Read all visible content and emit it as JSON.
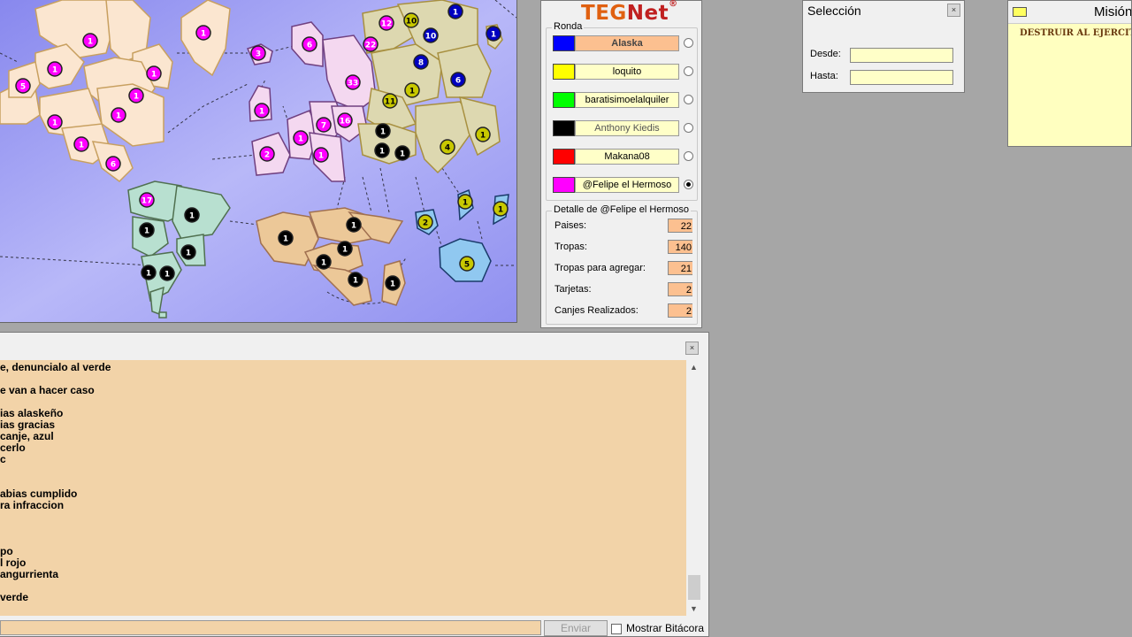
{
  "map": {
    "territories": [
      {
        "army": "1",
        "color": "#ff00ff"
      },
      {
        "army": "1",
        "color": "#ff00ff"
      },
      {
        "army": "1",
        "color": "#ff00ff"
      },
      {
        "army": "5",
        "color": "#ff00ff"
      },
      {
        "army": "1",
        "color": "#ff00ff"
      },
      {
        "army": "1",
        "color": "#ff00ff"
      },
      {
        "army": "1",
        "color": "#ff00ff"
      },
      {
        "army": "1",
        "color": "#ff00ff"
      },
      {
        "army": "1",
        "color": "#ff00ff"
      },
      {
        "army": "6",
        "color": "#ff00ff"
      },
      {
        "army": "17",
        "color": "#ff00ff"
      },
      {
        "army": "1",
        "color": "#000000"
      },
      {
        "army": "1",
        "color": "#000000"
      },
      {
        "army": "1",
        "color": "#000000"
      },
      {
        "army": "1",
        "color": "#000000"
      },
      {
        "army": "1",
        "color": "#000000"
      },
      {
        "army": "3",
        "color": "#ff00ff"
      },
      {
        "army": "1",
        "color": "#ff00ff"
      },
      {
        "army": "6",
        "color": "#ff00ff"
      },
      {
        "army": "33",
        "color": "#ff00ff"
      },
      {
        "army": "2",
        "color": "#ff00ff"
      },
      {
        "army": "1",
        "color": "#ff00ff"
      },
      {
        "army": "7",
        "color": "#ff00ff"
      },
      {
        "army": "16",
        "color": "#ff00ff"
      },
      {
        "army": "1",
        "color": "#ff00ff"
      },
      {
        "army": "12",
        "color": "#ff00ff"
      },
      {
        "army": "22",
        "color": "#ff00ff"
      },
      {
        "army": "10",
        "color": "#c8c800"
      },
      {
        "army": "1",
        "color": "#0000c0"
      },
      {
        "army": "10",
        "color": "#0000c0"
      },
      {
        "army": "8",
        "color": "#0000c0"
      },
      {
        "army": "6",
        "color": "#0000c0"
      },
      {
        "army": "1",
        "color": "#0000c0"
      },
      {
        "army": "1",
        "color": "#c8c800"
      },
      {
        "army": "11",
        "color": "#c8c800"
      },
      {
        "army": "4",
        "color": "#c8c800"
      },
      {
        "army": "1",
        "color": "#c8c800"
      },
      {
        "army": "1",
        "color": "#000000"
      },
      {
        "army": "1",
        "color": "#000000"
      },
      {
        "army": "1",
        "color": "#000000"
      },
      {
        "army": "1",
        "color": "#000000"
      },
      {
        "army": "1",
        "color": "#000000"
      },
      {
        "army": "1",
        "color": "#000000"
      },
      {
        "army": "1",
        "color": "#000000"
      },
      {
        "army": "1",
        "color": "#000000"
      },
      {
        "army": "1",
        "color": "#000000"
      },
      {
        "army": "2",
        "color": "#c8c800"
      },
      {
        "army": "1",
        "color": "#c8c800"
      },
      {
        "army": "1",
        "color": "#c8c800"
      },
      {
        "army": "5",
        "color": "#c8c800"
      }
    ]
  },
  "teg": {
    "logo_a": "TEG",
    "logo_b": "Net",
    "logo_mark": "®",
    "ronda_label": "Ronda",
    "players": [
      {
        "name": "Alaska",
        "color": "#0000ff",
        "active": true,
        "selected": false
      },
      {
        "name": "loquito",
        "color": "#ffff00",
        "active": false,
        "selected": false
      },
      {
        "name": "baratisimoelalquiler",
        "color": "#00ff00",
        "active": false,
        "selected": false
      },
      {
        "name": "Anthony Kiedis",
        "color": "#000000",
        "active": false,
        "selected": false,
        "gray": true
      },
      {
        "name": "Makana08",
        "color": "#ff0000",
        "active": false,
        "selected": false
      },
      {
        "name": "@Felipe el Hermoso",
        "color": "#ff00ff",
        "active": false,
        "selected": true
      }
    ],
    "detail_title": "Detalle de @Felipe el Hermoso",
    "details": [
      {
        "label": "Paises:",
        "value": "22"
      },
      {
        "label": "Tropas:",
        "value": "140"
      },
      {
        "label": "Tropas para agregar:",
        "value": "21"
      },
      {
        "label": "Tarjetas:",
        "value": "2"
      },
      {
        "label": "Canjes Realizados:",
        "value": "2"
      }
    ]
  },
  "seleccion": {
    "title": "Selección",
    "close": "×",
    "desde_label": "Desde:",
    "hasta_label": "Hasta:",
    "desde_value": "",
    "hasta_value": ""
  },
  "mision": {
    "title": "Misión",
    "text": "DESTRUIR AL EJERCITO"
  },
  "chat": {
    "close": "×",
    "lines": [
      "e, denuncialo al verde",
      "",
      "e van a hacer caso",
      "",
      "ias alaskeño",
      "ias gracias",
      " canje, azul",
      "cerlo",
      "c",
      "",
      "",
      "abias cumplido",
      "ra infraccion",
      "",
      "",
      "",
      "po",
      "l rojo",
      "angurrienta",
      "",
      "verde"
    ],
    "send_label": "Enviar",
    "show_log_label": "Mostrar Bitácora",
    "scroll_up": "▲",
    "scroll_down": "▼"
  }
}
